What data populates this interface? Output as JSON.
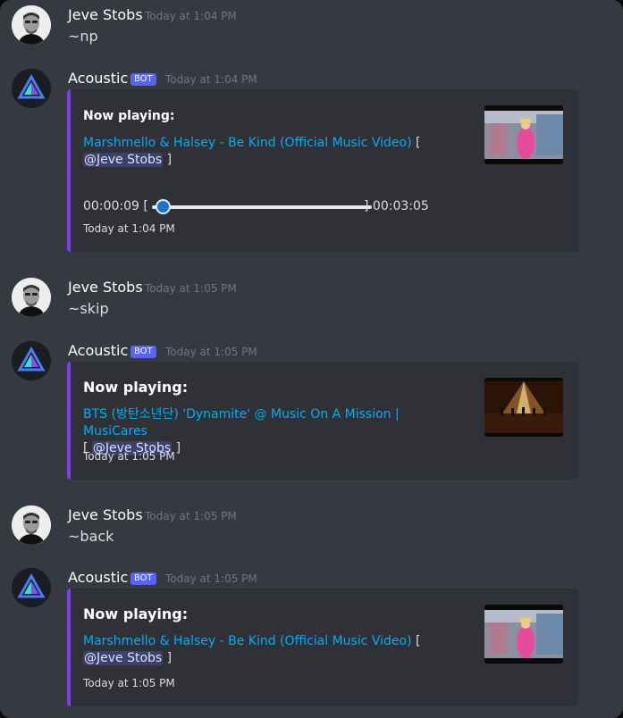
{
  "colors": {
    "background": "#36393f",
    "embed_background": "#2f3136",
    "embed_accent": "#7a3ff2",
    "link": "#00aff4",
    "bot_tag": "#5865f2"
  },
  "messages": [
    {
      "author": "Jeve Stobs",
      "timestamp": "Today at 1:04 PM",
      "text": "~np"
    },
    {
      "author": "Acoustic",
      "bot_tag": "BOT",
      "timestamp": "Today at 1:04 PM",
      "embed": {
        "title": "Now playing:",
        "track": "Marshmello & Halsey - Be Kind (Official Music Video)",
        "bracket_open": " [",
        "mention": "@Jeve Stobs",
        "bracket_close": "]",
        "elapsed": "00:00:09 [",
        "total": "] 00:03:05",
        "progress_fraction": 0.05,
        "footer": "Today at 1:04 PM",
        "thumbnail": "be-kind-video-thumbnail"
      }
    },
    {
      "author": "Jeve Stobs",
      "timestamp": "Today at 1:05 PM",
      "text": "~skip"
    },
    {
      "author": "Acoustic",
      "bot_tag": "BOT",
      "timestamp": "Today at 1:05 PM",
      "embed": {
        "title": "Now playing:",
        "track": "BTS (방탄소년단) 'Dynamite' @ Music On A Mission | MusiCares",
        "bracket_open": " [",
        "mention": "@Jeve Stobs",
        "bracket_close": "]",
        "footer": "Today at 1:05 PM",
        "thumbnail": "dynamite-stage-thumbnail"
      }
    },
    {
      "author": "Jeve Stobs",
      "timestamp": "Today at 1:05 PM",
      "text": "~back"
    },
    {
      "author": "Acoustic",
      "bot_tag": "BOT",
      "timestamp": "Today at 1:05 PM",
      "embed": {
        "title": "Now playing:",
        "track": "Marshmello & Halsey - Be Kind (Official Music Video)",
        "bracket_open": " [",
        "mention": "@Jeve Stobs",
        "bracket_close": "]",
        "footer": "Today at 1:05 PM",
        "thumbnail": "be-kind-video-thumbnail"
      }
    }
  ]
}
